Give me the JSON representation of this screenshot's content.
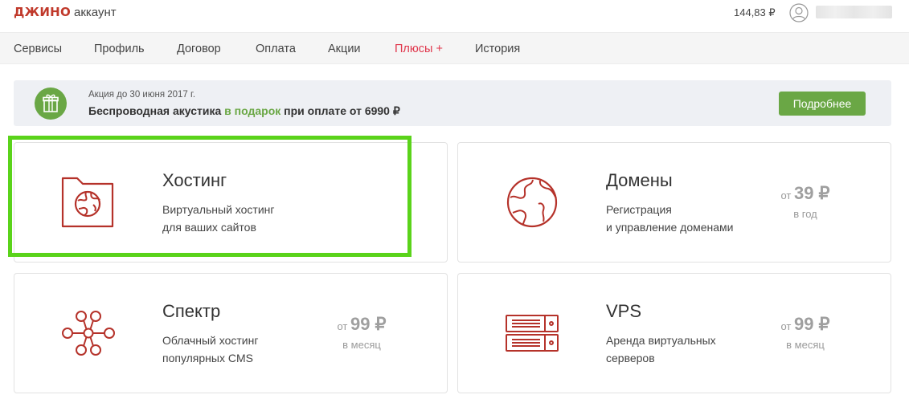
{
  "header": {
    "logo": "ДЖИНО",
    "logo_sub": "аккаунт",
    "balance": "144,83 ₽",
    "icons": {
      "user": "user-icon"
    }
  },
  "nav": {
    "items": [
      {
        "label": "Сервисы"
      },
      {
        "label": "Профиль"
      },
      {
        "label": "Договор"
      },
      {
        "label": "Оплата"
      },
      {
        "label": "Акции"
      },
      {
        "label": "Плюсы +",
        "accent": "#e0364c"
      },
      {
        "label": "История"
      }
    ]
  },
  "promo": {
    "icon": "gift-icon",
    "small_text": "Акция до 30 июня 2017 г.",
    "text_before": "Беспроводная акустика ",
    "text_highlight": "в подарок",
    "text_after": " при оплате от 6990 ₽",
    "button": "Подробнее",
    "accent": "#6aa745"
  },
  "cards": [
    {
      "icon": "hosting-folder-globe-icon",
      "title": "Хостинг",
      "desc_line1": "Виртуальный хостинг",
      "desc_line2": "для ваших сайтов",
      "selected": true
    },
    {
      "icon": "globe-icon",
      "title": "Домены",
      "desc_line1": "Регистрация",
      "desc_line2": "и управление доменами",
      "price_prefix": "от",
      "price": "39 ₽",
      "period": "в год"
    },
    {
      "icon": "network-nodes-icon",
      "title": "Спектр",
      "desc_line1": "Облачный хостинг",
      "desc_line2": "популярных CMS",
      "price_prefix": "от",
      "price": "99 ₽",
      "period": "в месяц"
    },
    {
      "icon": "server-icon",
      "title": "VPS",
      "desc_line1": "Аренда виртуальных",
      "desc_line2": "серверов",
      "price_prefix": "от",
      "price": "99 ₽",
      "period": "в месяц"
    }
  ],
  "colors": {
    "brand": "#c0392b",
    "icon_stroke": "#b5322a",
    "accent_green": "#6aa745",
    "selection": "#5ad31a"
  }
}
